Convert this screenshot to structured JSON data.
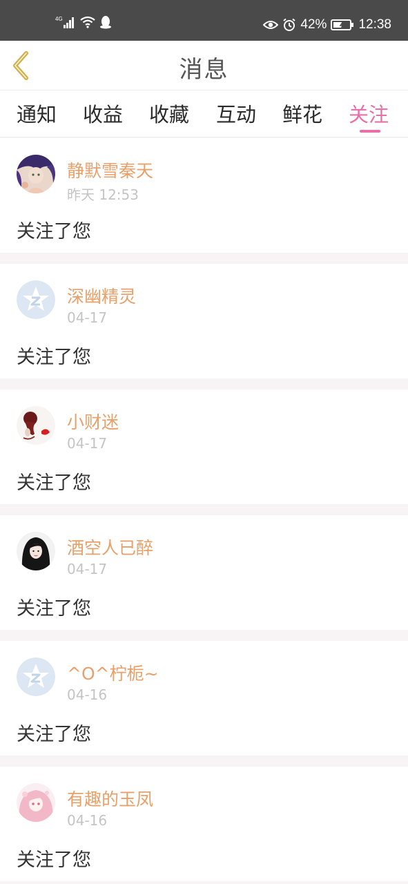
{
  "status_bar": {
    "network": "4G",
    "battery": "42%",
    "time": "12:38"
  },
  "header": {
    "title": "消息"
  },
  "tabs": [
    {
      "label": "通知",
      "active": false
    },
    {
      "label": "收益",
      "active": false
    },
    {
      "label": "收藏",
      "active": false
    },
    {
      "label": "互动",
      "active": false
    },
    {
      "label": "鲜花",
      "active": false
    },
    {
      "label": "关注",
      "active": true
    }
  ],
  "notifications": [
    {
      "user": "静默雪秦天",
      "time": "昨天 12:53",
      "message": "关注了您",
      "avatar": "anime-girl-purple"
    },
    {
      "user": "深幽精灵",
      "time": "04-17",
      "message": "关注了您",
      "avatar": "default-qq-star"
    },
    {
      "user": "小财迷",
      "time": "04-17",
      "message": "关注了您",
      "avatar": "red-flower"
    },
    {
      "user": "酒空人已醉",
      "time": "04-17",
      "message": "关注了您",
      "avatar": "black-hair-girl"
    },
    {
      "user": "^O^柠栀~",
      "time": "04-16",
      "message": "关注了您",
      "avatar": "default-qq-star"
    },
    {
      "user": "有趣的玉凤",
      "time": "04-16",
      "message": "关注了您",
      "avatar": "anime-girl-pink"
    }
  ],
  "colors": {
    "status_bar": "#4a4a4a",
    "accent_pink": "#e870a6",
    "username_orange": "#e8a06a",
    "time_gray": "#c4c4c4",
    "back_arrow": "#d2b04c"
  }
}
